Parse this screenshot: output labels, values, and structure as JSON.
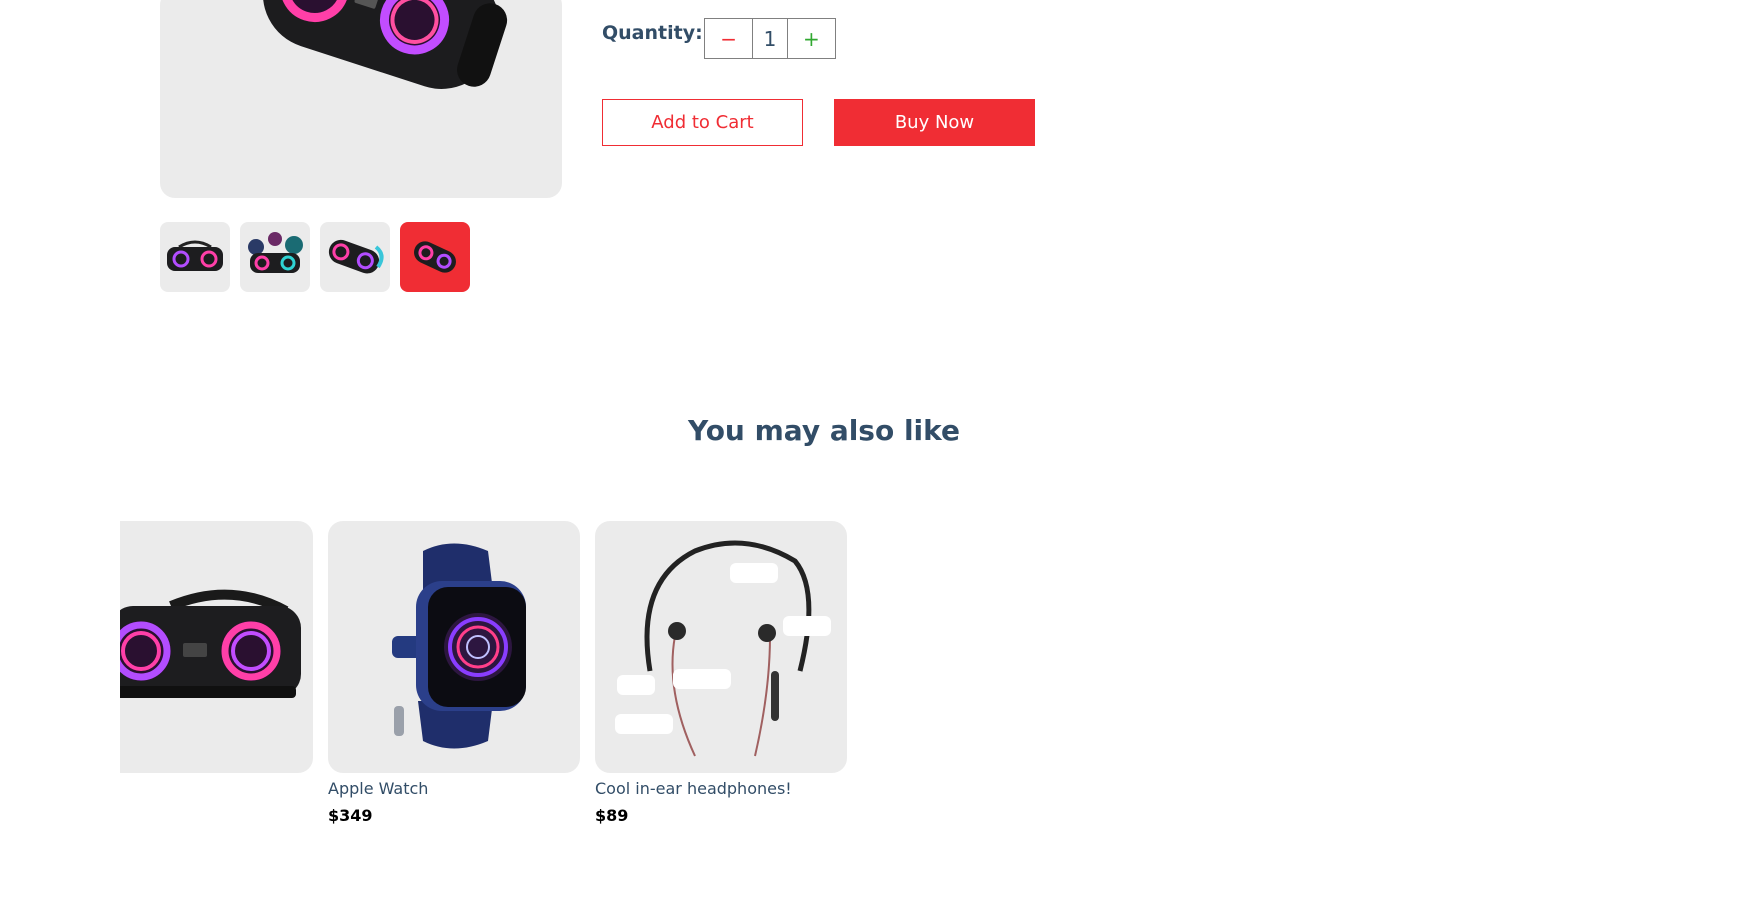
{
  "product": {
    "main_image": "speaker-image",
    "thumbnails": [
      {
        "image": "speaker-thumb-1",
        "selected": false
      },
      {
        "image": "speaker-thumb-2",
        "selected": false
      },
      {
        "image": "speaker-thumb-3",
        "selected": false
      },
      {
        "image": "speaker-thumb-4",
        "selected": true
      }
    ],
    "quantity_label": "Quantity:",
    "quantity": "1",
    "minus_symbol": "−",
    "plus_symbol": "+",
    "add_to_cart_label": "Add to Cart",
    "buy_now_label": "Buy Now"
  },
  "related": {
    "title": "You may also like",
    "items": [
      {
        "name": "",
        "price": "",
        "image": "speaker-image"
      },
      {
        "name": "Apple Watch",
        "price": "$349",
        "image": "smartwatch-image"
      },
      {
        "name": "Cool in-ear headphones!",
        "price": "$89",
        "image": "neckband-earphones-image"
      }
    ]
  },
  "colors": {
    "accent": "#f02d34",
    "heading": "#324d67",
    "card_bg": "#ebebeb",
    "plus": "#31a831"
  }
}
